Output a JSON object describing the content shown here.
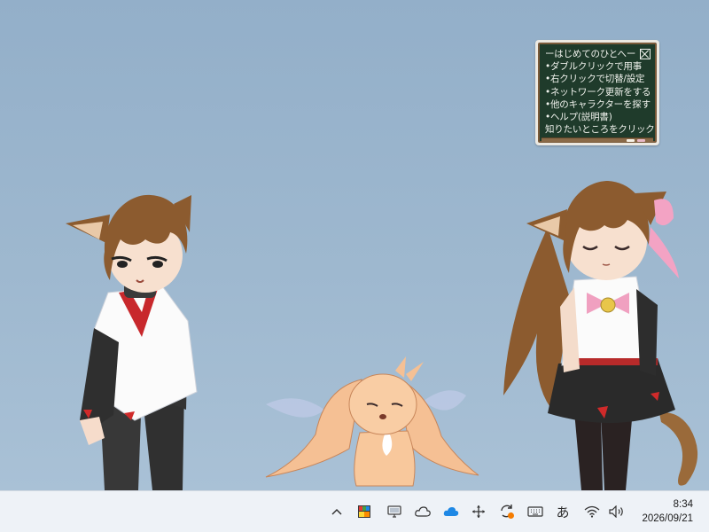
{
  "board": {
    "title": "ーはじめてのひとへー",
    "items": [
      "•ダブルクリックで用事",
      "•右クリックで切替/設定",
      "•ネットワーク更新をする",
      "•他のキャラクターを探す",
      "•ヘルプ(説明書)",
      "知りたいところをクリック"
    ]
  },
  "taskbar": {
    "tray_icons": [
      "chevron-up-icon",
      "app-palette-icon",
      "monitor-icon",
      "cloud-icon",
      "onedrive-icon",
      "move-arrows-icon",
      "sync-update-icon",
      "keyboard-icon",
      "ime-icon",
      "wifi-icon",
      "volume-icon"
    ],
    "ime_label": "あ",
    "clock": {
      "time": "8:34",
      "date": "2026/09/21"
    }
  },
  "colors": {
    "desktop": "#9db6ce",
    "blackboard": "#1f3b2b",
    "taskbar": "#eef2f7",
    "onedrive": "#1e88e5"
  }
}
